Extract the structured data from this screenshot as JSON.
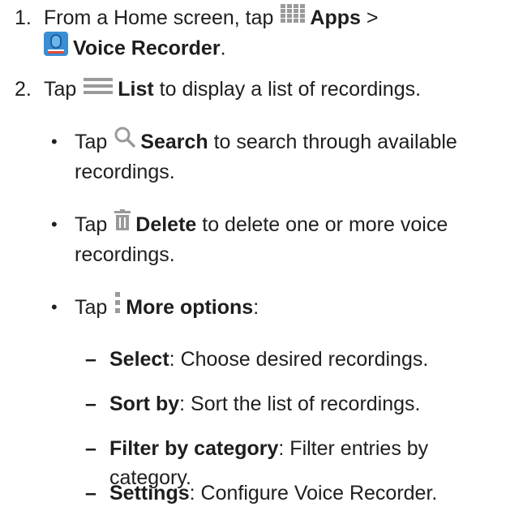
{
  "steps": [
    {
      "number": "1.",
      "prefix": "From a Home screen, tap",
      "apps_label": "Apps",
      "sep": ">",
      "voice_recorder_label": "Voice Recorder",
      "end": "."
    },
    {
      "number": "2.",
      "prefix": "Tap",
      "list_label": "List",
      "suffix": "to display a list of recordings."
    }
  ],
  "bullets": [
    {
      "dot": "•",
      "prefix": "Tap",
      "label": "Search",
      "suffix_line1": "to search through available",
      "suffix_line2": "recordings."
    },
    {
      "dot": "•",
      "prefix": "Tap",
      "label": "Delete",
      "suffix_line1": "to delete one or more voice",
      "suffix_line2": "recordings."
    },
    {
      "dot": "•",
      "prefix": "Tap",
      "label": "More options",
      "suffix": ":"
    }
  ],
  "options": [
    {
      "dash": "–",
      "label": "Select",
      "text": ": Choose desired recordings."
    },
    {
      "dash": "–",
      "label": "Sort by",
      "text": ": Sort the list of recordings."
    },
    {
      "dash": "–",
      "label": "Filter by category",
      "text_line1": ": Filter entries by",
      "text_line2": "category."
    },
    {
      "dash": "–",
      "label": "Settings",
      "text": ": Configure Voice Recorder."
    }
  ],
  "icons": {
    "apps": "apps-grid-icon",
    "voice_recorder": "voice-recorder-app-icon",
    "list": "list-icon",
    "search": "search-icon",
    "delete": "trash-icon",
    "more": "more-options-icon"
  },
  "colors": {
    "text": "#1e1e1e",
    "icon_gray": "#9a9a9a",
    "recorder_blue": "#3a8fd4",
    "recorder_red": "#e04a3a"
  }
}
